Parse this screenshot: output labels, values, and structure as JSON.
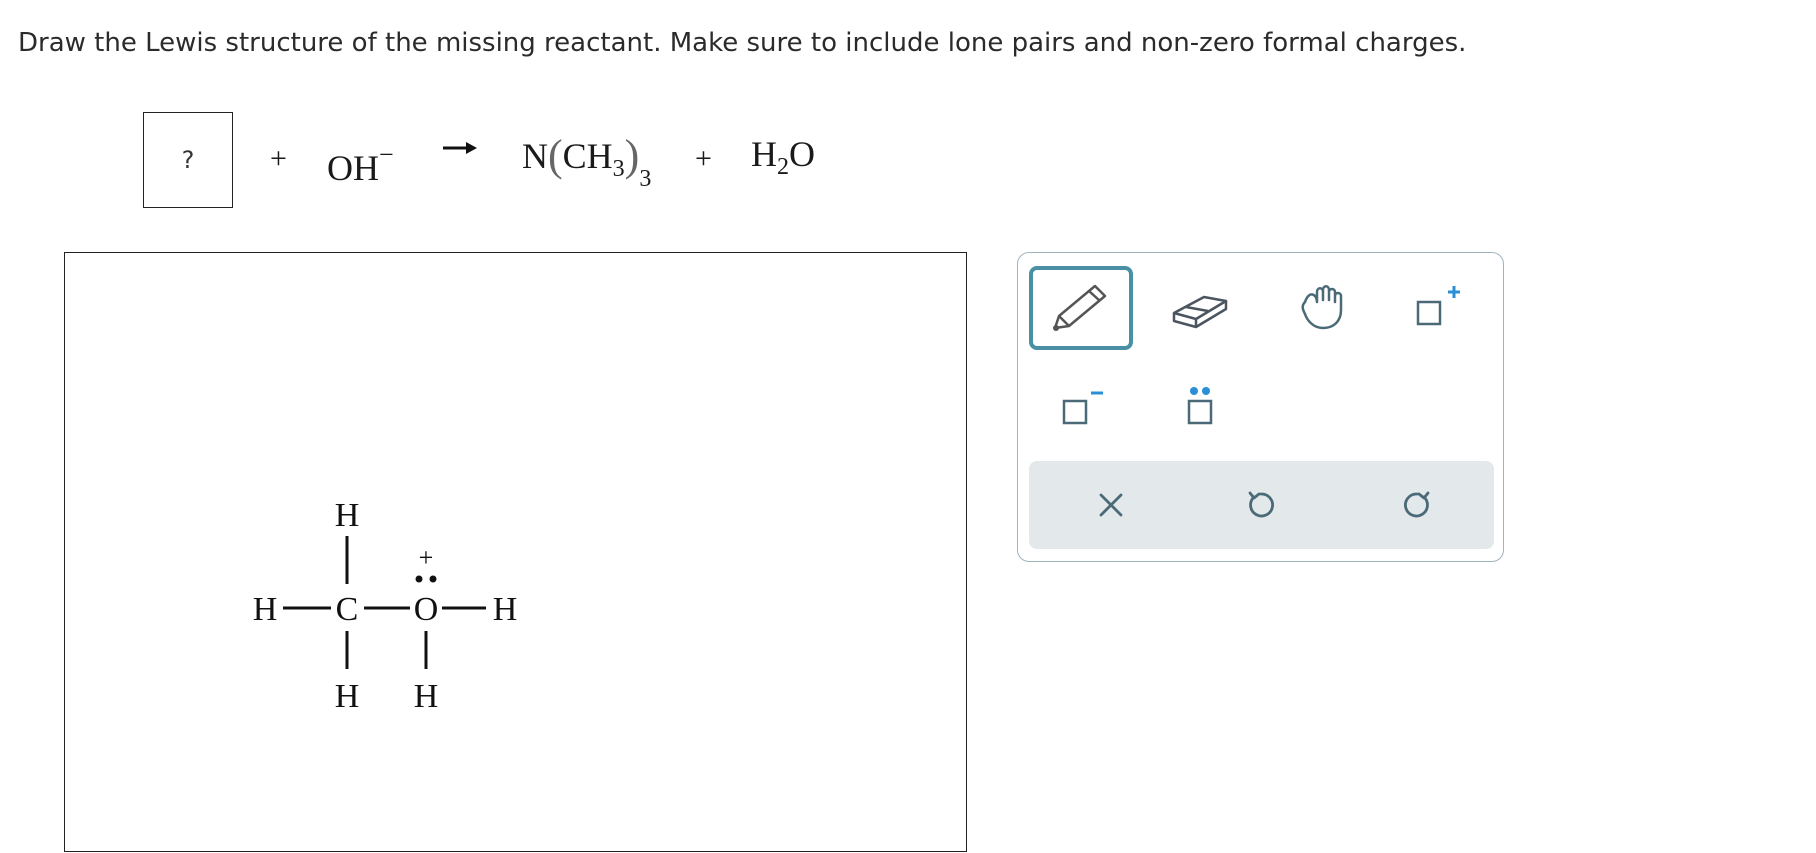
{
  "prompt": "Draw the Lewis structure of the missing reactant. Make sure to include lone pairs and non-zero formal charges.",
  "reaction": {
    "missing": "?",
    "plus": "+",
    "reactant2": {
      "main": "OH",
      "charge": "−"
    },
    "product1": {
      "n": "N",
      "ch": "CH",
      "sub_inner": "3",
      "sub_outer": "3"
    },
    "product2": {
      "h": "H",
      "sub": "2",
      "o": "O"
    }
  },
  "molecule": {
    "atoms": {
      "c": "C",
      "o": "O",
      "h_top": "H",
      "h_left": "H",
      "h_bottom_c": "H",
      "h_right": "H",
      "h_bottom_o": "H"
    },
    "o_charge": "+"
  },
  "tools": [
    "pencil-tool",
    "eraser-tool",
    "hand-tool",
    "positive-charge-tool",
    "negative-charge-tool",
    "lone-pair-tool"
  ],
  "actions": [
    "clear",
    "undo",
    "redo"
  ],
  "colors": {
    "accent": "#4a90a4",
    "icon": "#4b6a78",
    "plus_charge": "#2a8fd6",
    "dots": "#2a8fd6"
  }
}
